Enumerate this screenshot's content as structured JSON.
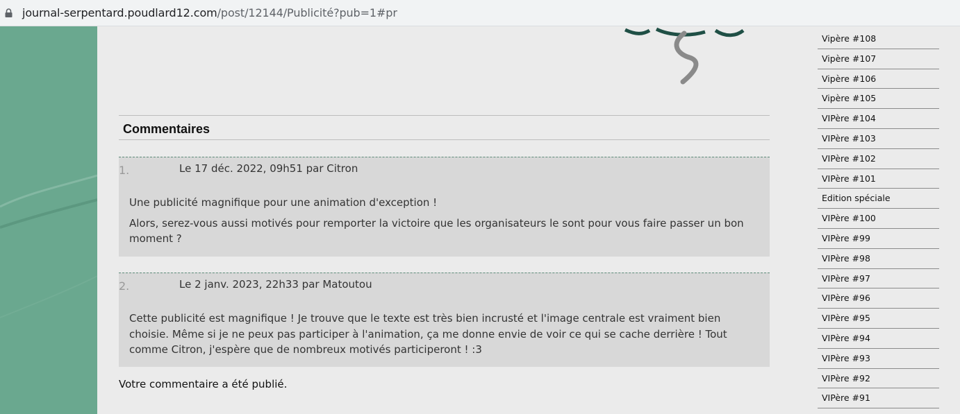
{
  "browser": {
    "url_host": "journal-serpentard.poudlard12.com",
    "url_path": "/post/12144/Publicité?pub=1#pr"
  },
  "comments": {
    "title": "Commentaires",
    "items": [
      {
        "number": "1.",
        "meta": "Le 17 déc. 2022, 09h51 par Citron",
        "paragraphs": [
          "Une publicité magnifique pour une animation d'exception !",
          "Alors, serez-vous aussi motivés pour remporter la victoire que les organisateurs le sont pour vous faire passer un bon moment ?"
        ]
      },
      {
        "number": "2.",
        "meta": "Le 2 janv. 2023, 22h33 par Matoutou",
        "paragraphs": [
          "Cette publicité est magnifique ! Je trouve que le texte est très bien incrusté et l'image centrale est vraiment bien choisie. Même si je ne peux pas participer à l'animation, ça me donne envie de voir ce qui se cache derrière ! Tout comme Citron, j'espère que de nombreux motivés participeront ! :3"
        ]
      }
    ],
    "published_message": "Votre commentaire a été publié."
  },
  "sidebar": {
    "items": [
      "Vipère #108",
      "Vipère #107",
      "Vipère #106",
      "Vipère #105",
      "VIPère #104",
      "VIPère #103",
      "VIPère #102",
      "VIPère #101",
      "Edition spéciale",
      "VIPère #100",
      "VIPère #99",
      "VIPère #98",
      "VIPère #97",
      "VIPère #96",
      "VIPère #95",
      "VIPère #94",
      "VIPère #93",
      "VIPère #92",
      "VIPère #91"
    ]
  },
  "colors": {
    "left_band": "#6aa88f",
    "page_bg": "#ebebeb",
    "comment_bg": "#d8d8d8"
  }
}
